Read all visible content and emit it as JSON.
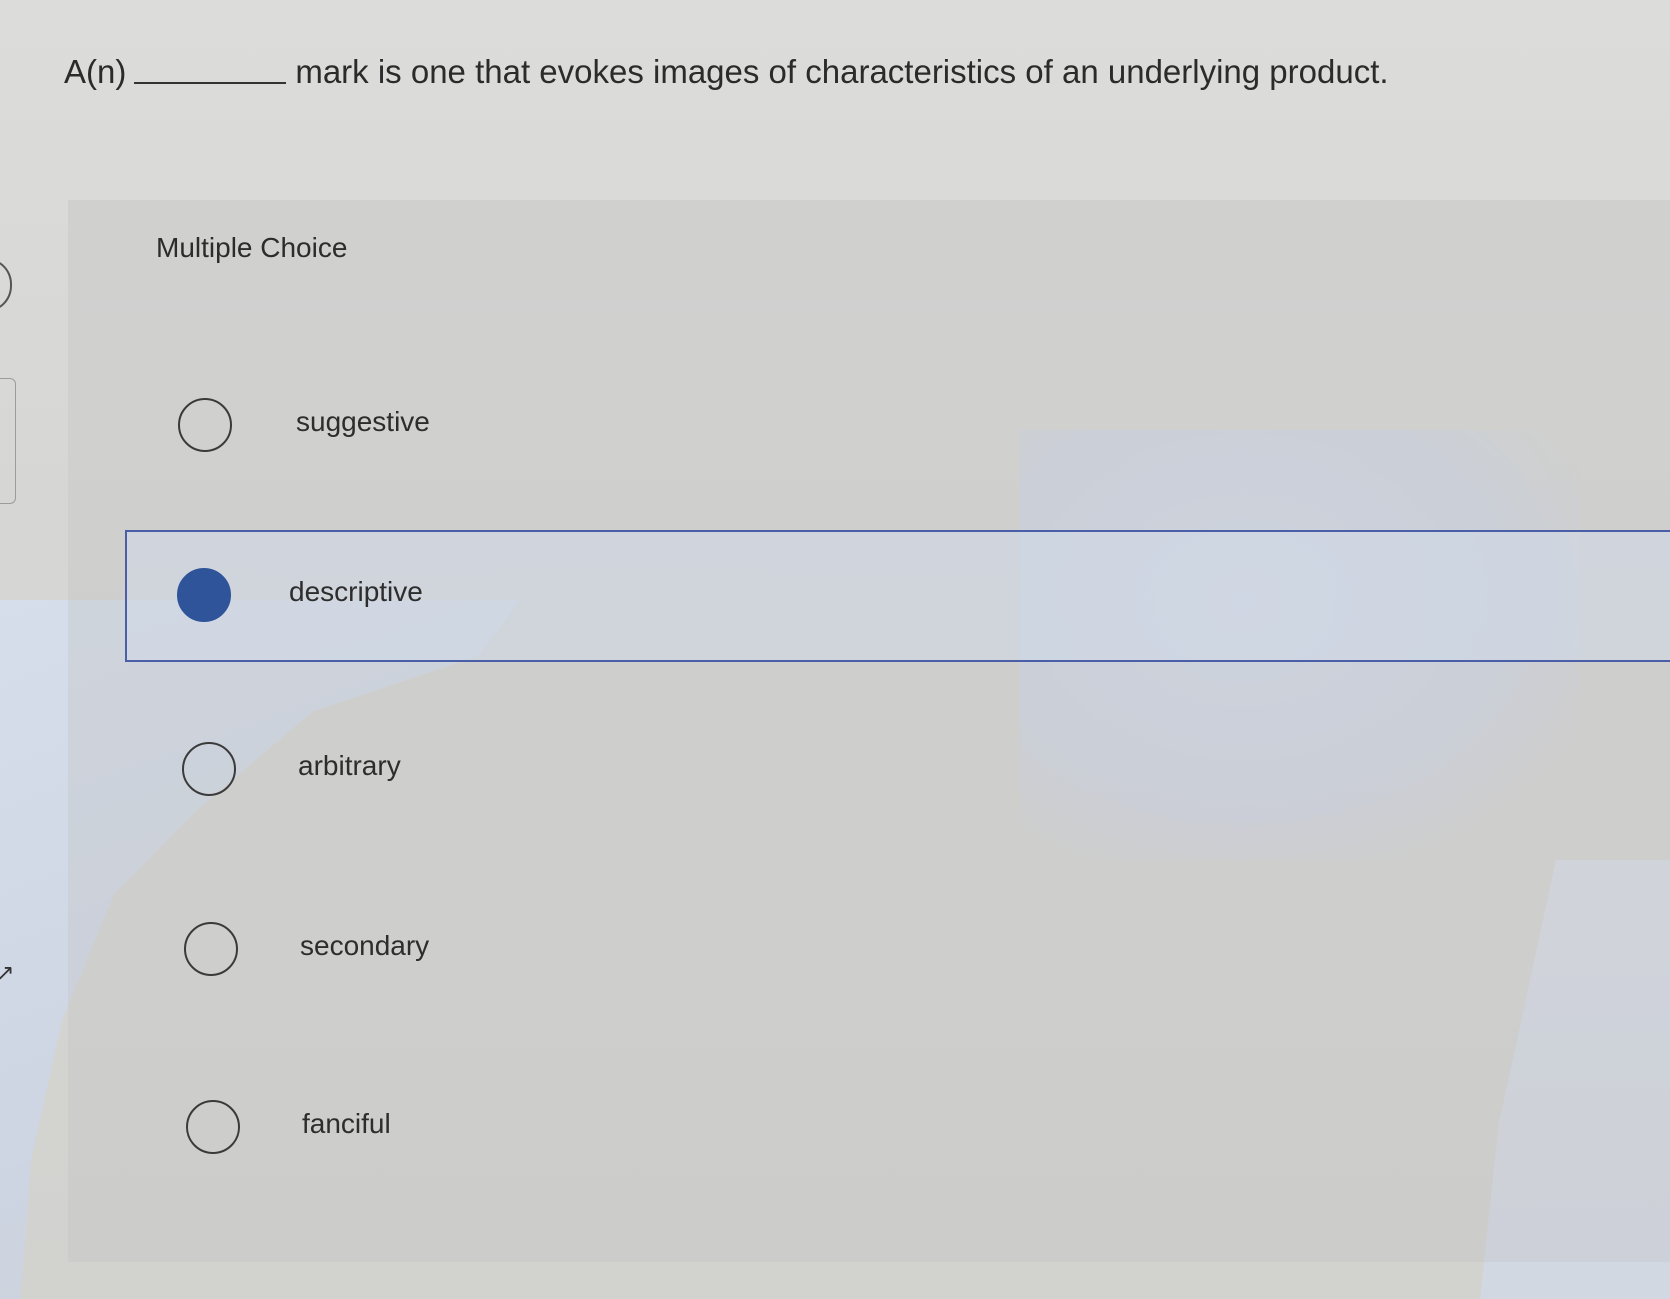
{
  "question": {
    "prefix": "A(n)",
    "suffix": "mark is one that evokes images of characteristics of an underlying product."
  },
  "panel": {
    "title": "Multiple Choice"
  },
  "options": [
    {
      "label": "suggestive",
      "selected": false
    },
    {
      "label": "descriptive",
      "selected": true
    },
    {
      "label": "arbitrary",
      "selected": false
    },
    {
      "label": "secondary",
      "selected": false
    },
    {
      "label": "fanciful",
      "selected": false
    }
  ],
  "colors": {
    "selected_radio": "#2f5499",
    "selected_border": "#4a5fa8"
  }
}
